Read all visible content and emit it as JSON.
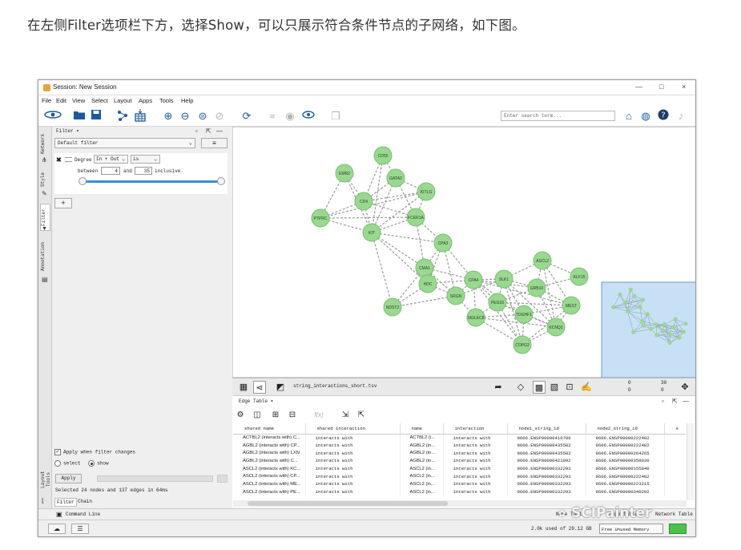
{
  "caption": "在左侧Filter选项栏下方，选择Show，可以只展示符合条件节点的子网络，如下图。",
  "window": {
    "title": "Session: New Session",
    "controls": [
      "—",
      "□",
      "×"
    ]
  },
  "menu": [
    "File",
    "Edit",
    "View",
    "Select",
    "Layout",
    "Apps",
    "Tools",
    "Help"
  ],
  "toolbar": {
    "search_placeholder": "Enter search term..."
  },
  "side_tabs": [
    "Network",
    "Style",
    "Filter",
    "Annotation"
  ],
  "bottom_side_tab": "Layout Tools",
  "filter_panel": {
    "header": "Filter ▾",
    "filter_select": "Default filter",
    "menu_button": "≡",
    "degree": {
      "label": "Degree",
      "direction": "In + Out",
      "op": "is",
      "between": "between",
      "min": "4",
      "and": "and",
      "max": "35",
      "inclusive": "inclusive.",
      "slider_low": 0.0,
      "slider_high": 1.0
    },
    "add_button": "+",
    "apply_when_changes": "Apply when filter changes",
    "select_label": "select",
    "show_label": "show",
    "selected_mode": "show",
    "apply_button": "Apply",
    "selection_info": "Selected 24 nodes and 137 edges in 64ms",
    "tabs": [
      "Filter",
      "Chain"
    ]
  },
  "network": {
    "name": "string_interactions_short.tsv",
    "nodes": [
      "CD55",
      "EMR2",
      "GATA2",
      "KITLG",
      "CD4",
      "PTPRC",
      "FCER1A",
      "KIT",
      "CPA3",
      "CMA1",
      "HDC",
      "SRGN",
      "CPA4",
      "SLK1",
      "PEG10",
      "GRB10",
      "ASCL2",
      "KLF15",
      "NDST2",
      "SIGLEC8",
      "TDGHF1",
      "MEST",
      "KCNQ1",
      "COPG2"
    ],
    "readout": {
      "a": "0",
      "b": "0",
      "c": "30",
      "d": "0"
    }
  },
  "edge_table": {
    "header": "Edge Table ▾",
    "formula_button": "f(x)",
    "columns": [
      "shared name",
      "shared interaction",
      "name",
      "interaction",
      "node1_string_id",
      "node2_string_id",
      "s"
    ],
    "rows": [
      [
        "ACTBL2 (interacts with) C...",
        "interacts with",
        "ACTBL2 (i...",
        "interacts with",
        "9606.ENSP00000416706",
        "9606.ENSP00000222482"
      ],
      [
        "AGBL2 (interacts with) CP...",
        "interacts with",
        "AGBL2 (in...",
        "interacts with",
        "9606.ENSP00000435582",
        "9606.ENSP00000222482"
      ],
      [
        "AGBL2 (interacts with) LXN",
        "interacts with",
        "AGBL2 (in...",
        "interacts with",
        "9606.ENSP00000435582",
        "9606.ENSP00000264265"
      ],
      [
        "AGBL2 (interacts with) C...",
        "interacts with",
        "AGBL2 (in...",
        "interacts with",
        "9606.ENSP00000421092",
        "9606.ENSP00000358030"
      ],
      [
        "ASCL2 (interacts with) KC...",
        "interacts with",
        "ASCL2 (in...",
        "interacts with",
        "9606.ENSP00000332293",
        "9606.ENSP00000155840"
      ],
      [
        "ASCL2 (interacts with) CP...",
        "interacts with",
        "ASCL2 (in...",
        "interacts with",
        "9606.ENSP00000332293",
        "9606.ENSP00000222482"
      ],
      [
        "ASCL2 (interacts with) ME...",
        "interacts with",
        "ASCL2 (in...",
        "interacts with",
        "9606.ENSP00000332293",
        "9606.ENSP00000223215"
      ],
      [
        "ASCL2 (interacts with) PE...",
        "interacts with",
        "ASCL2 (in...",
        "interacts with",
        "9606.ENSP00000332293",
        "9606.ENSP00000340292"
      ]
    ]
  },
  "bottom": {
    "command_line": "Command Line",
    "node_table": "Node Table",
    "edge_table": "Edge Table",
    "network_table": "Network Table"
  },
  "status": {
    "memory": "2.0k used of 29.12 GB",
    "free_button": "Free Unused Memory"
  },
  "watermark": "SCIPainter",
  "colors": {
    "node_fill": "#98d88f",
    "node_stroke": "#7bbf72",
    "edge": "#9a9a9a",
    "toolbar_icon": "#1d5a9c",
    "overview_bg": "#c7e0f5",
    "slider": "#3b8fd1"
  }
}
